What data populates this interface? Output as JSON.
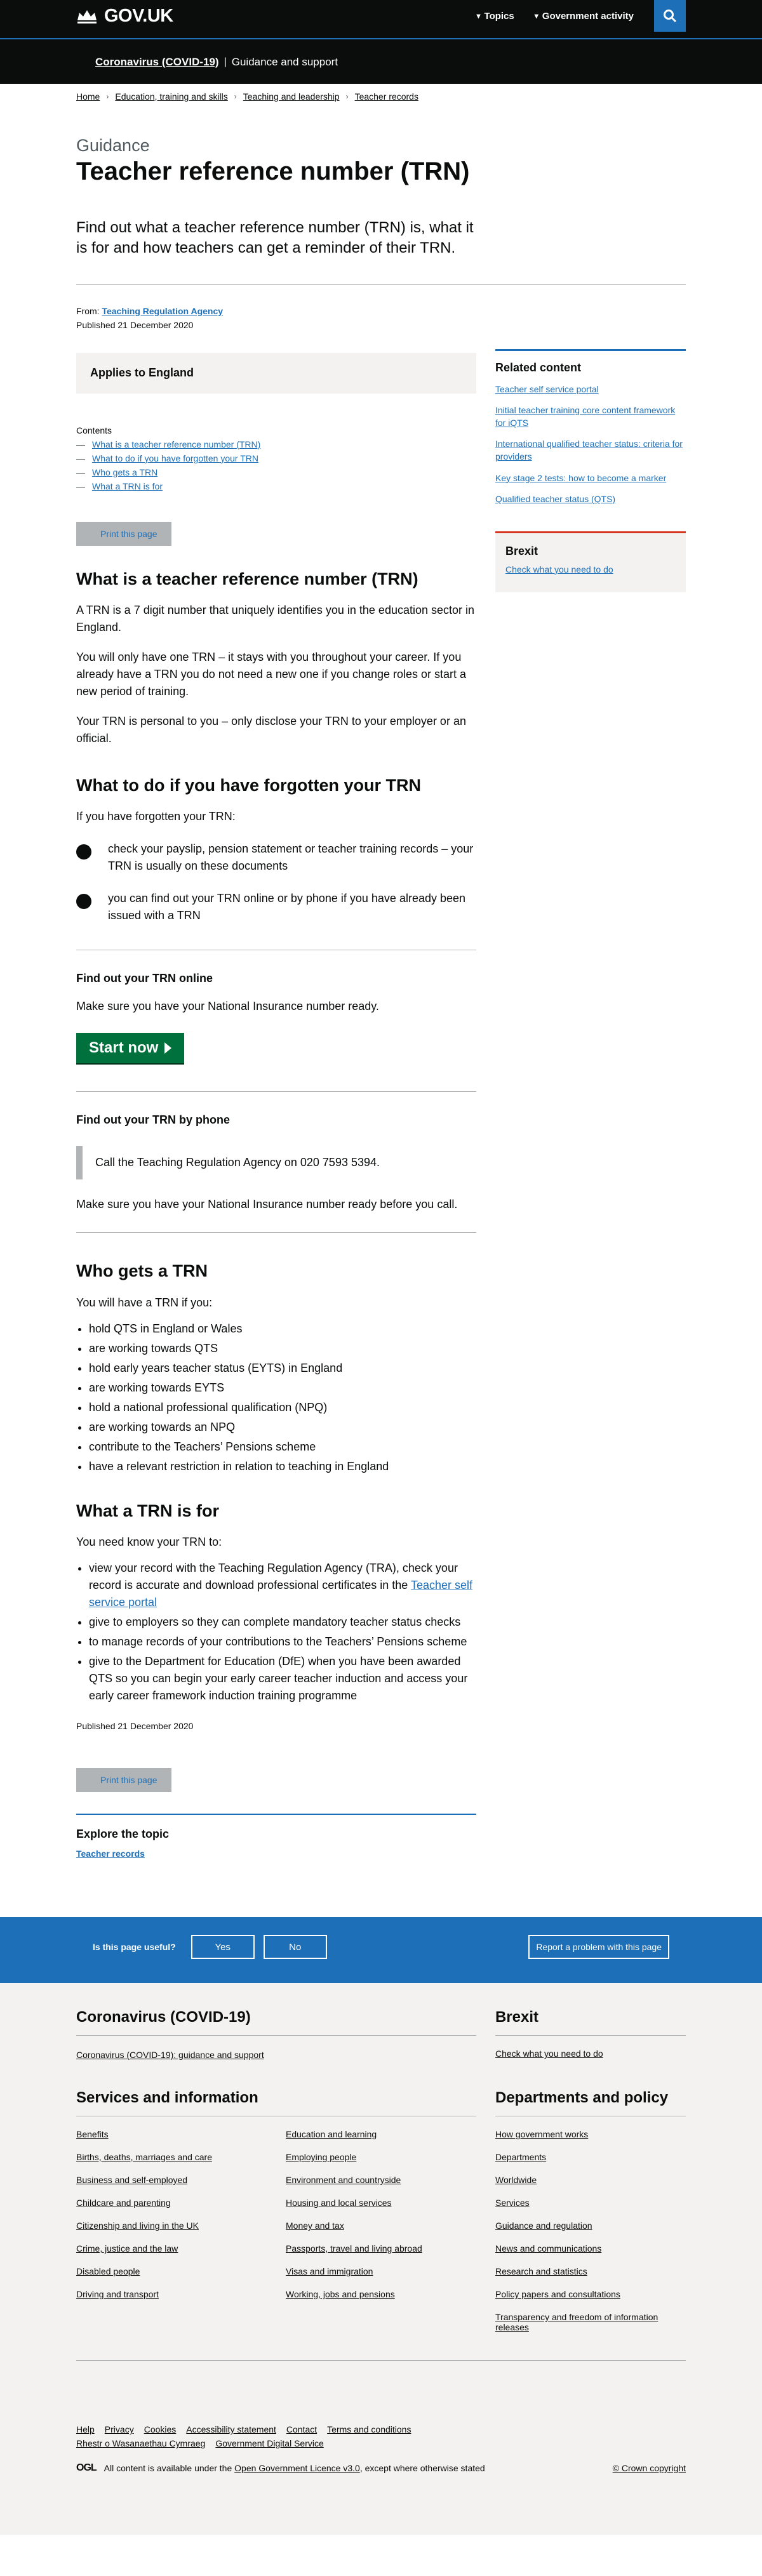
{
  "header": {
    "logo_text": "GOV.UK",
    "nav": [
      "Topics",
      "Government activity"
    ]
  },
  "covid": {
    "link": "Coronavirus (COVID-19)",
    "sub": "Guidance and support"
  },
  "breadcrumbs": [
    "Home",
    "Education, training and skills",
    "Teaching and leadership",
    "Teacher records"
  ],
  "page": {
    "kind": "Guidance",
    "title": "Teacher reference number (TRN)",
    "lead": "Find out what a teacher reference number (TRN) is, what it is for and how teachers can get a reminder of their TRN.",
    "from_label": "From:",
    "from_org": "Teaching Regulation Agency",
    "published": "Published 21 December 2020",
    "applies": "Applies to England",
    "contents_label": "Contents",
    "contents": [
      "What is a teacher reference number (TRN)",
      "What to do if you have forgotten your TRN",
      "Who gets a TRN",
      "What a TRN is for"
    ],
    "print": "Print this page"
  },
  "section1": {
    "heading": "What is a teacher reference number (TRN)",
    "p1": "A TRN is a 7 digit number that uniquely identifies you in the education sector in England.",
    "p2": "You will only have one TRN – it stays with you throughout your career. If you already have a TRN you do not need a new one if you change roles or start a new period of training.",
    "p3": "Your TRN is personal to you – only disclose your TRN to your employer or an official."
  },
  "section2": {
    "heading": "What to do if you have forgotten your TRN",
    "intro": "If you have forgotten your TRN:",
    "bullets": [
      "check your payslip, pension statement or teacher training records – your TRN is usually on these documents",
      "you can find out your TRN online or by phone if you have already been issued with a TRN"
    ],
    "online_heading": "Find out your TRN online",
    "online_text": "Make sure you have your National Insurance number ready.",
    "start_button": "Start now",
    "phone_heading": "Find out your TRN by phone",
    "phone_inset": "Call the Teaching Regulation Agency on 020 7593 5394.",
    "phone_text": "Make sure you have your National Insurance number ready before you call."
  },
  "section3": {
    "heading": "Who gets a TRN",
    "intro": "You will have a TRN if you:",
    "items": [
      "hold QTS in England or Wales",
      "are working towards QTS",
      "hold early years teacher status (EYTS) in England",
      "are working towards EYTS",
      "hold a national professional qualification (NPQ)",
      "are working towards an NPQ",
      "contribute to the Teachers’ Pensions scheme",
      "have a relevant restriction in relation to teaching in England"
    ]
  },
  "section4": {
    "heading": "What a TRN is for",
    "intro": "You need know your TRN to:",
    "item1_text": "view your record with the Teaching Regulation Agency (TRA), check your record is accurate and download professional certificates in the ",
    "item1_link": "Teacher self service portal",
    "items": [
      "give to employers so they can complete mandatory teacher status checks",
      "to manage records of your contributions to the Teachers’ Pensions scheme",
      "give to the Department for Education (DfE) when you have been awarded QTS so you can begin your early career teacher induction and access your early career framework induction training programme"
    ],
    "published": "Published 21 December 2020"
  },
  "explore": {
    "heading": "Explore the topic",
    "link": "Teacher records"
  },
  "sidebar": {
    "related_heading": "Related content",
    "related": [
      "Teacher self service portal",
      "Initial teacher training core content framework for iQTS",
      "International qualified teacher status: criteria for providers",
      "Key stage 2 tests: how to become a marker",
      "Qualified teacher status (QTS)"
    ],
    "brexit_heading": "Brexit",
    "brexit_link": "Check what you need to do"
  },
  "feedback": {
    "question": "Is this page useful?",
    "yes": "Yes",
    "no": "No",
    "report": "Report a problem with this page"
  },
  "footer": {
    "covid_heading": "Coronavirus (COVID-19)",
    "covid_link": "Coronavirus (COVID-19): guidance and support",
    "brexit_heading": "Brexit",
    "brexit_link": "Check what you need to do",
    "services_heading": "Services and information",
    "services_col1": [
      "Benefits",
      "Births, deaths, marriages and care",
      "Business and self-employed",
      "Childcare and parenting",
      "Citizenship and living in the UK",
      "Crime, justice and the law",
      "Disabled people",
      "Driving and transport"
    ],
    "services_col2": [
      "Education and learning",
      "Employing people",
      "Environment and countryside",
      "Housing and local services",
      "Money and tax",
      "Passports, travel and living abroad",
      "Visas and immigration",
      "Working, jobs and pensions"
    ],
    "dept_heading": "Departments and policy",
    "dept_links": [
      "How government works",
      "Departments",
      "Worldwide",
      "Services",
      "Guidance and regulation",
      "News and communications",
      "Research and statistics",
      "Policy papers and consultations",
      "Transparency and freedom of information releases"
    ],
    "meta_links": [
      "Help",
      "Privacy",
      "Cookies",
      "Accessibility statement",
      "Contact",
      "Terms and conditions",
      "Rhestr o Wasanaethau Cymraeg",
      "Government Digital Service"
    ],
    "ogl": "OGL",
    "licence_prefix": "All content is available under the ",
    "licence_link": "Open Government Licence v3.0",
    "licence_suffix": ", except where otherwise stated",
    "crown": "© Crown copyright"
  }
}
